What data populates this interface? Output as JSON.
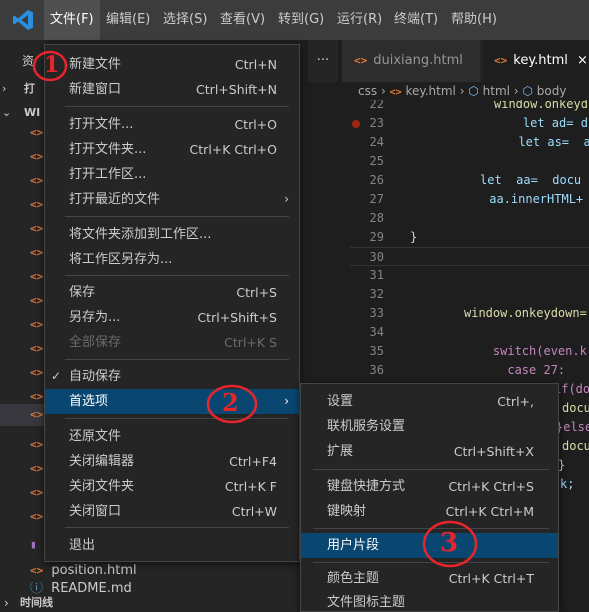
{
  "titlebar": {
    "menus": [
      "文件(F)",
      "编辑(E)",
      "选择(S)",
      "查看(V)",
      "转到(G)",
      "运行(R)",
      "终端(T)",
      "帮助(H)"
    ]
  },
  "explorer": {
    "header_left": "资",
    "open_editors_label": "打",
    "workspace_label": "WI",
    "files_bottom": [
      "position.html",
      "README.md"
    ],
    "timeline_label": "时间线"
  },
  "tabs": [
    {
      "label": "duixiang.html",
      "icon": "html-file-icon",
      "active": false
    },
    {
      "label": "key.html",
      "icon": "html-file-icon",
      "active": true
    }
  ],
  "more_label": "···",
  "close_label": "×",
  "breadcrumb": [
    "css",
    "key.html",
    "html",
    "body"
  ],
  "editor": {
    "lines": [
      {
        "no": "22",
        "code": "window.onkeyd"
      },
      {
        "no": "23",
        "code": "    let ad= d",
        "breakpoint": true
      },
      {
        "no": "24",
        "code": "  let as=  a"
      },
      {
        "no": "25",
        "code": ""
      },
      {
        "no": "26",
        "code": "let  aa=  docu"
      },
      {
        "no": "27",
        "code": " aa.innerHTML+"
      },
      {
        "no": "28",
        "code": ""
      },
      {
        "no": "29",
        "code": "}"
      },
      {
        "no": "30",
        "code": ""
      },
      {
        "no": "31",
        "code": ""
      },
      {
        "no": "32",
        "code": ""
      },
      {
        "no": "33",
        "code": "window.onkeydown="
      },
      {
        "no": "34",
        "code": ""
      },
      {
        "no": "35",
        "code": "    switch(even.k"
      },
      {
        "no": "36",
        "code": "      case 27:"
      }
    ],
    "fragments": [
      "if(do",
      "docu",
      "}else",
      "docu",
      "}",
      "k;"
    ]
  },
  "file_menu": {
    "items": [
      {
        "label": "新建文件",
        "kb": "Ctrl+N"
      },
      {
        "label": "新建窗口",
        "kb": "Ctrl+Shift+N"
      },
      {
        "sep": true
      },
      {
        "label": "打开文件...",
        "kb": "Ctrl+O"
      },
      {
        "label": "打开文件夹...",
        "kb": "Ctrl+K Ctrl+O"
      },
      {
        "label": "打开工作区...",
        "kb": ""
      },
      {
        "label": "打开最近的文件",
        "kb": "",
        "submenu": true
      },
      {
        "sep": true
      },
      {
        "label": "将文件夹添加到工作区...",
        "kb": ""
      },
      {
        "label": "将工作区另存为...",
        "kb": ""
      },
      {
        "sep": true
      },
      {
        "label": "保存",
        "kb": "Ctrl+S"
      },
      {
        "label": "另存为...",
        "kb": "Ctrl+Shift+S"
      },
      {
        "label": "全部保存",
        "kb": "Ctrl+K S",
        "disabled": true
      },
      {
        "sep": true
      },
      {
        "label": "自动保存",
        "kb": "",
        "checked": true
      },
      {
        "label": "首选项",
        "kb": "",
        "submenu": true,
        "highlight": true
      },
      {
        "sep": true
      },
      {
        "label": "还原文件",
        "kb": ""
      },
      {
        "label": "关闭编辑器",
        "kb": "Ctrl+F4"
      },
      {
        "label": "关闭文件夹",
        "kb": "Ctrl+K F"
      },
      {
        "label": "关闭窗口",
        "kb": "Ctrl+W"
      },
      {
        "sep": true
      },
      {
        "label": "退出",
        "kb": ""
      }
    ]
  },
  "pref_menu": {
    "items": [
      {
        "label": "设置",
        "kb": "Ctrl+,"
      },
      {
        "label": "联机服务设置",
        "kb": ""
      },
      {
        "label": "扩展",
        "kb": "Ctrl+Shift+X"
      },
      {
        "sep": true
      },
      {
        "label": "键盘快捷方式",
        "kb": "Ctrl+K Ctrl+S"
      },
      {
        "label": "键映射",
        "kb": "Ctrl+K Ctrl+M"
      },
      {
        "sep": true
      },
      {
        "label": "用户片段",
        "kb": "",
        "highlight": true
      },
      {
        "sep": true
      },
      {
        "label": "颜色主题",
        "kb": "Ctrl+K Ctrl+T"
      },
      {
        "label": "文件图标主题",
        "kb": ""
      }
    ]
  },
  "annotations": [
    "1",
    "2",
    "3"
  ],
  "colors": {
    "menu_highlight": "#094771",
    "html_icon": "#e37933",
    "annotation": "#e8242c"
  }
}
